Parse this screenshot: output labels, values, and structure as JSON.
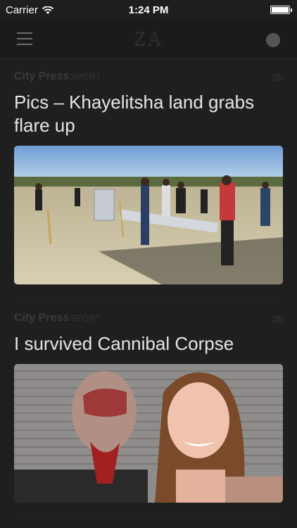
{
  "status_bar": {
    "carrier": "Carrier",
    "time": "1:24 PM"
  },
  "nav": {
    "logo": "ZA",
    "menu_icon": "hamburger-menu-icon",
    "profile_icon": "profile-dot-icon"
  },
  "articles": [
    {
      "source": "City Press",
      "category": "SPORT",
      "age": "2h",
      "headline": "Pics – Khayelitsha land grabs flare up",
      "image": "photo of people carrying corrugated metal sheets on sandy land"
    },
    {
      "source": "City Press",
      "category": "SPORT",
      "age": "2h",
      "headline": "I survived Cannibal Corpse",
      "image": "photo of bloodied man beside smiling woman"
    }
  ],
  "colors": {
    "background": "#1f1f1f",
    "headline": "#e6e6e6",
    "muted": "#3a3a3a"
  }
}
